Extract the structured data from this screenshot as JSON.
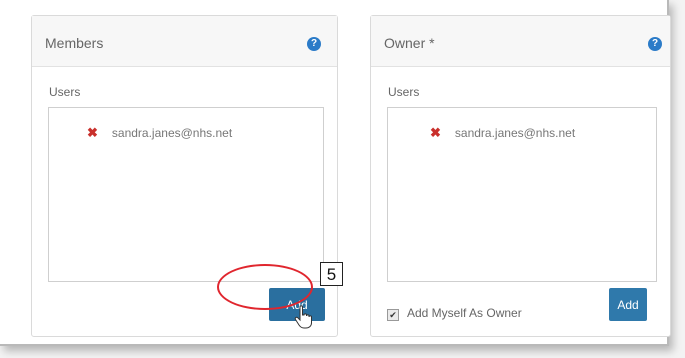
{
  "members": {
    "title": "Members",
    "help_icon": "?",
    "users_label": "Users",
    "users": [
      {
        "email": "sandra.janes@nhs.net",
        "remove_icon": "✖"
      }
    ],
    "add_label": "Add"
  },
  "owner": {
    "title": "Owner *",
    "help_icon": "?",
    "users_label": "Users",
    "users": [
      {
        "email": "sandra.janes@nhs.net",
        "remove_icon": "✖"
      }
    ],
    "checkbox_label": "Add Myself As Owner",
    "checkbox_checked": true,
    "checkbox_mark": "✔",
    "add_label": "Add"
  },
  "annotation": {
    "step_number": "5"
  },
  "colors": {
    "button": "#2f79ab",
    "help_icon": "#2b7bc8",
    "remove_icon": "#c9302c",
    "highlight": "#e0262e"
  }
}
